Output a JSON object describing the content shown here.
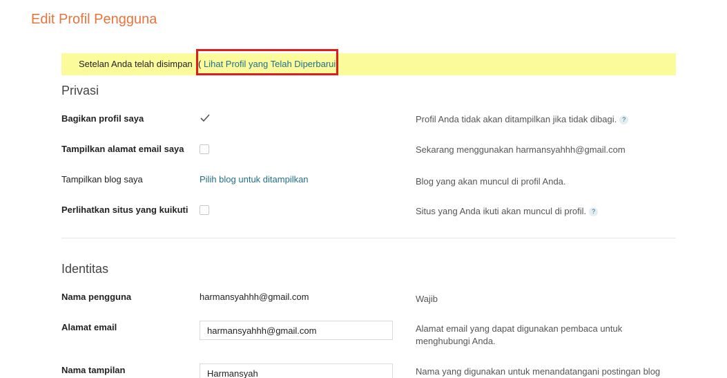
{
  "page": {
    "title": "Edit Profil Pengguna"
  },
  "notice": {
    "message": "Setelan Anda telah disimpan",
    "paren": "(",
    "link_label": "Lihat Profil yang Telah Diperbarui",
    "highlight_color": "#e01b1b",
    "background_color": "#fbfb9b"
  },
  "privacy": {
    "section_title": "Privasi",
    "rows": [
      {
        "label": "Bagikan profil saya",
        "checked": true,
        "help": "Profil Anda tidak akan ditampilkan jika tidak dibagi.",
        "help_icon": "?"
      },
      {
        "label": "Tampilkan alamat email saya",
        "checked": false,
        "help": "Sekarang menggunakan harmansyahhh@gmail.com"
      },
      {
        "label": "Tampilkan blog saya",
        "link": "Pilih blog untuk ditampilkan",
        "help": "Blog yang akan muncul di profil Anda."
      },
      {
        "label": "Perlihatkan situs yang kuikuti",
        "checked": false,
        "help": "Situs yang Anda ikuti akan muncul di profil.",
        "help_icon": "?"
      }
    ]
  },
  "identity": {
    "section_title": "Identitas",
    "username": {
      "label": "Nama pengguna",
      "value": "harmansyahhh@gmail.com",
      "help": "Wajib"
    },
    "email": {
      "label": "Alamat email",
      "value": "harmansyahhh@gmail.com",
      "help": "Alamat email yang dapat digunakan pembaca untuk menghubungi Anda."
    },
    "display_name": {
      "label": "Nama tampilan",
      "value": "Harmansyah",
      "help": "Nama yang digunakan untuk menandatangani postingan blog"
    }
  },
  "colors": {
    "accent": "#e8743b",
    "link": "#1f6f8b"
  }
}
